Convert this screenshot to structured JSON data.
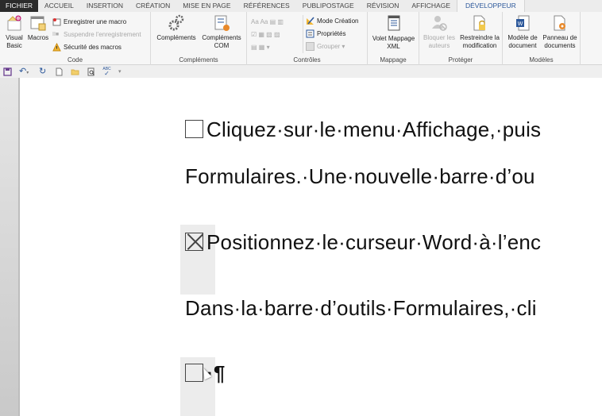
{
  "tabs": [
    "FICHIER",
    "ACCUEIL",
    "INSERTION",
    "CRÉATION",
    "MISE EN PAGE",
    "RÉFÉRENCES",
    "PUBLIPOSTAGE",
    "RÉVISION",
    "AFFICHAGE",
    "DÉVELOPPEUR"
  ],
  "active_tab": "DÉVELOPPEUR",
  "ribbon": {
    "code": {
      "label": "Code",
      "visual_basic": "Visual Basic",
      "macros": "Macros",
      "record_macro": "Enregistrer une macro",
      "pause_recording": "Suspendre l'enregistrement",
      "macro_security": "Sécurité des macros"
    },
    "addins": {
      "label": "Compléments",
      "complements": "Compléments",
      "com_addins": "Compléments COM"
    },
    "controls": {
      "label": "Contrôles",
      "design_mode": "Mode Création",
      "properties": "Propriétés",
      "group": "Grouper"
    },
    "mapping": {
      "label": "Mappage",
      "xml_mapping_pane": "Volet Mappage XML"
    },
    "protect": {
      "label": "Protéger",
      "block_authors": "Bloquer les auteurs",
      "restrict_editing": "Restreindre la modification"
    },
    "templates": {
      "label": "Modèles",
      "document_template": "Modèle de document",
      "document_panel": "Panneau de documents"
    }
  },
  "qat": [
    "save-icon",
    "undo-icon",
    "redo-icon",
    "new-document-icon",
    "open-folder-icon",
    "print-preview-icon",
    "spelling-icon",
    "customize-qat-icon"
  ],
  "document": {
    "lines": [
      {
        "checkbox": "unchecked",
        "text": "Cliquez·sur·le·menu·Affichage,·puis"
      },
      {
        "text": "Formulaires.·Une·nouvelle·barre·d’ou"
      },
      {
        "checkbox": "checked",
        "text": "Positionnez·le·curseur·Word·à·l’enc"
      },
      {
        "text": "Dans·la·barre·d’outils·Formulaires,·cli"
      },
      {
        "checkbox": "unchecked",
        "text": "·¶"
      }
    ]
  },
  "colors": {
    "accent": "#2b579a",
    "file_tab": "#2b2b2b"
  }
}
